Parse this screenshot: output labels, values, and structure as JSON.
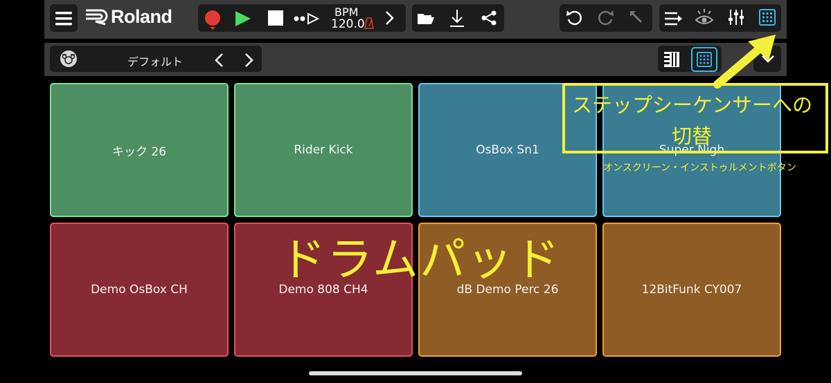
{
  "toolbar": {
    "brand": "Roland",
    "bpm_label": "BPM",
    "bpm_value": "120.0"
  },
  "kit_bar": {
    "kit_name": "デフォルト"
  },
  "pads": [
    {
      "label": "キック 26",
      "color": "green"
    },
    {
      "label": "Rider Kick",
      "color": "green"
    },
    {
      "label": "OsBox Sn1",
      "color": "blue"
    },
    {
      "label": "Super Nigh",
      "color": "blue"
    },
    {
      "label": "Demo OsBox CH",
      "color": "red"
    },
    {
      "label": "Demo 808 CH4",
      "color": "red"
    },
    {
      "label": "dB Demo Perc 26",
      "color": "orange"
    },
    {
      "label": "12BitFunk CY007",
      "color": "orange"
    }
  ],
  "annotations": {
    "callout_line1": "ステップシーケンサーへの",
    "callout_line2": "切替",
    "onscreen_instrument": "オンスクリーン・インストゥルメントボタン",
    "drum_pads": "ドラムパッド"
  },
  "colors": {
    "accent": "#39b8e6",
    "record": "#e53935",
    "play": "#4cd964",
    "annotation": "#f3ef3a"
  }
}
